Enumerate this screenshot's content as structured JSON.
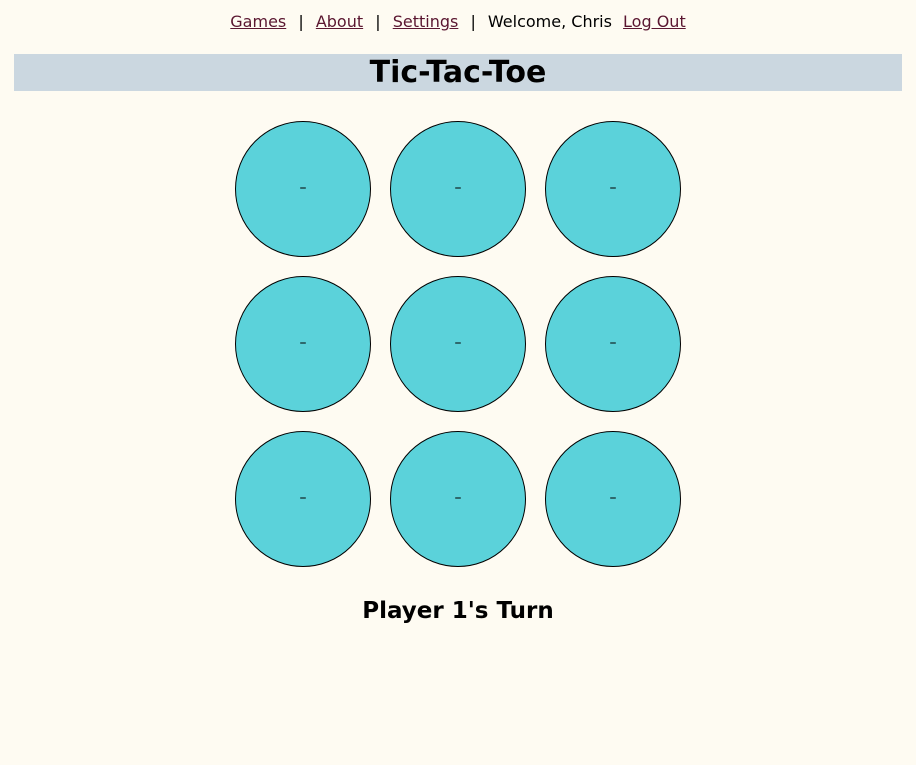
{
  "nav": {
    "games": "Games",
    "sep1": "|",
    "about": "About",
    "sep2": "|",
    "settings": "Settings",
    "sep3": "|",
    "welcome": "Welcome, Chris",
    "logout": "Log Out",
    "link_color": "#5a1630"
  },
  "header": {
    "title": "Tic-Tac-Toe",
    "bar_color": "#cbd7e0"
  },
  "board": {
    "cell_color": "#5bd2da",
    "cells": [
      "–",
      "–",
      "–",
      "–",
      "–",
      "–",
      "–",
      "–",
      "–"
    ]
  },
  "status": "Player 1's Turn"
}
